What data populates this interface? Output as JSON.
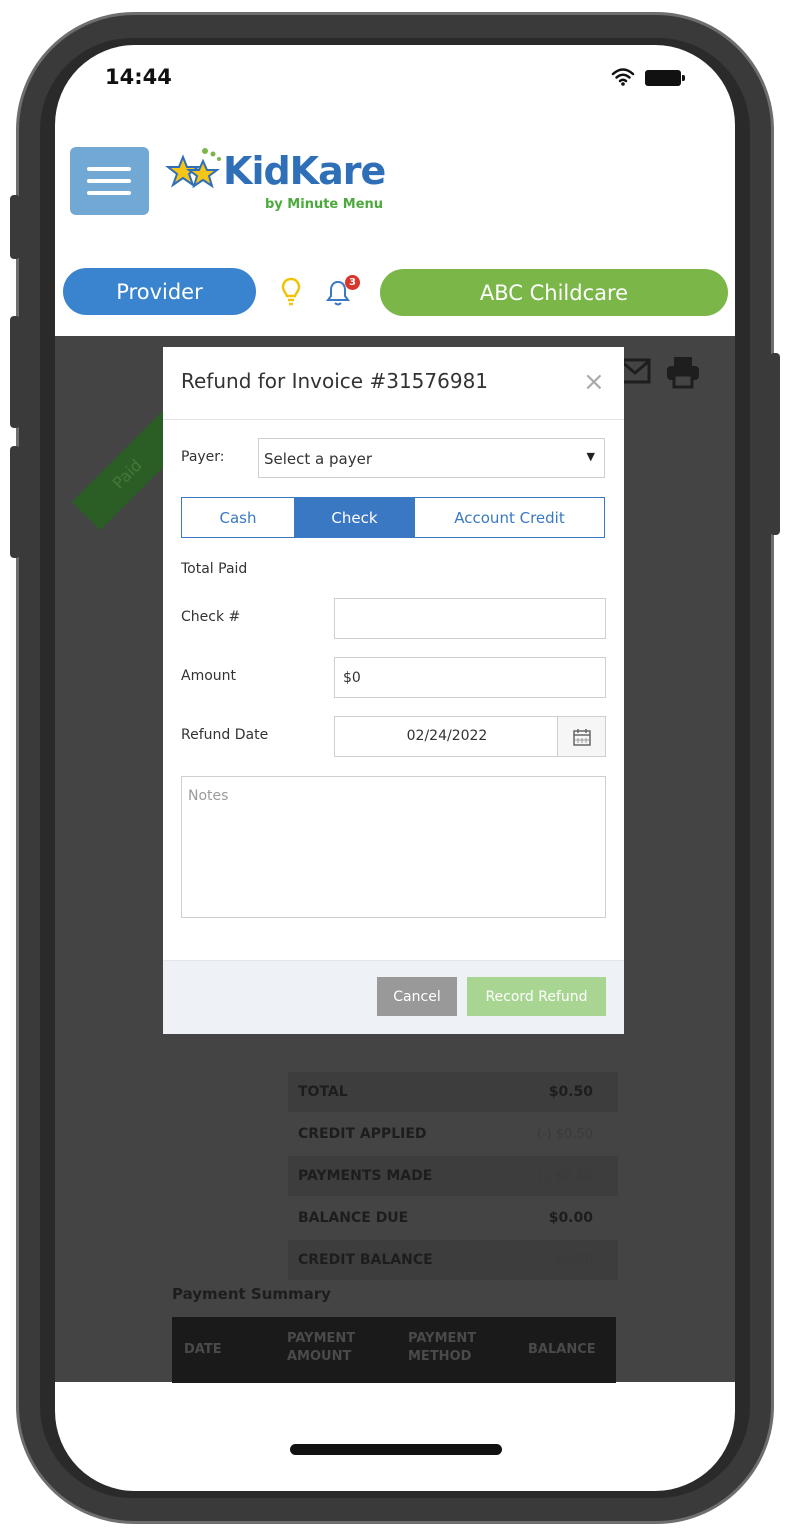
{
  "status_bar": {
    "time": "14:44"
  },
  "header": {
    "logo_main": "KidKare",
    "logo_sub": "by Minute Menu",
    "role_pill": "Provider",
    "notification_count": "3",
    "center_pill": "ABC Childcare"
  },
  "background": {
    "ribbon_text": "Paid",
    "summary": [
      {
        "label": "TOTAL",
        "value": "$0.50"
      },
      {
        "label": "CREDIT APPLIED",
        "value": "(-) $0.50"
      },
      {
        "label": "PAYMENTS MADE",
        "value": "(-) $0.50"
      },
      {
        "label": "BALANCE DUE",
        "value": "$0.00"
      },
      {
        "label": "CREDIT BALANCE",
        "value": "$0.50"
      }
    ],
    "payment_summary_title": "Payment Summary",
    "payment_summary_columns": [
      "DATE",
      "PAYMENT AMOUNT",
      "PAYMENT METHOD",
      "BALANCE"
    ]
  },
  "modal": {
    "title": "Refund for Invoice #31576981",
    "close_symbol": "×",
    "payer_label": "Payer:",
    "payer_value": "Select a payer",
    "tabs": [
      "Cash",
      "Check",
      "Account Credit"
    ],
    "active_tab": "Check",
    "total_paid_label": "Total Paid",
    "check_label": "Check #",
    "check_value": "",
    "amount_label": "Amount",
    "amount_value": "$0",
    "refund_date_label": "Refund Date",
    "refund_date_value": "02/24/2022",
    "notes_placeholder": "Notes",
    "cancel_label": "Cancel",
    "record_label": "Record Refund"
  },
  "colors": {
    "primary_blue": "#3a78c3",
    "kidkare_green": "#7ab648",
    "record_button": "#a8d692"
  }
}
